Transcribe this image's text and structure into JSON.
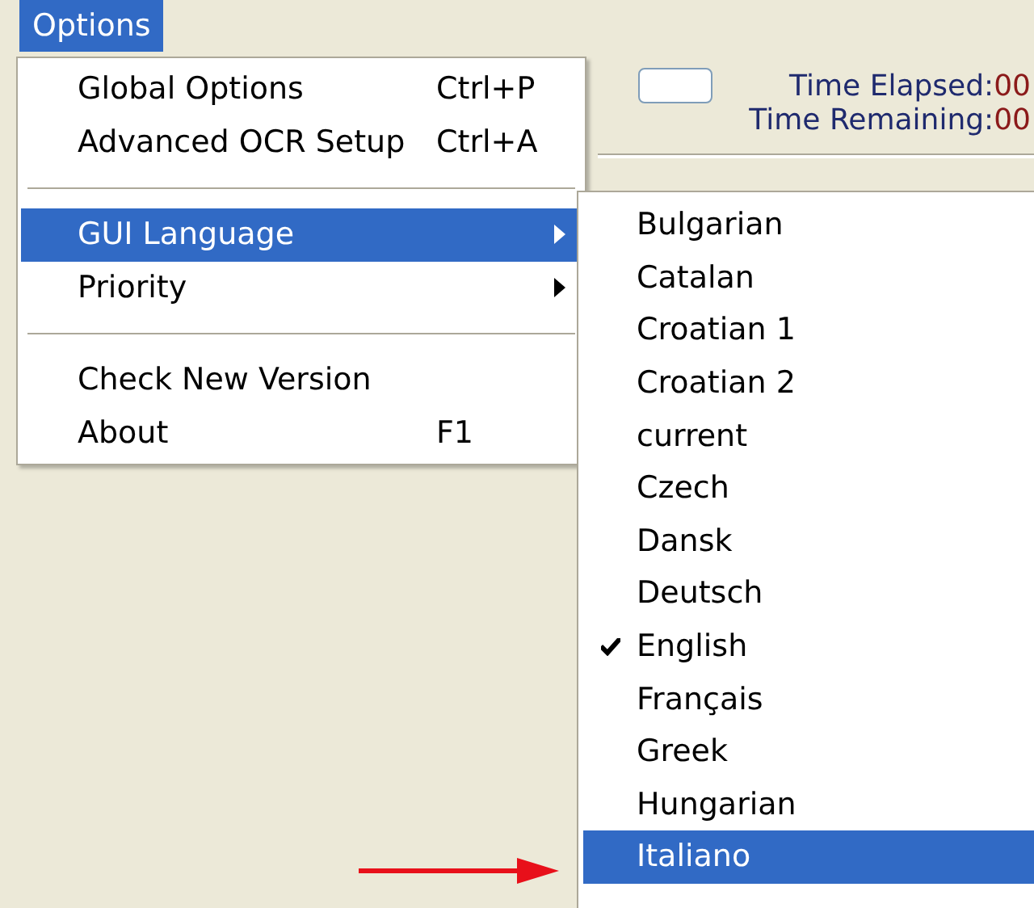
{
  "menubar": [
    {
      "label": "Options",
      "selected": true
    }
  ],
  "background_window": {
    "time_elapsed": {
      "label": "Time Elapsed:",
      "value": "00"
    },
    "time_remaining": {
      "label": "Time Remaining:",
      "value": "00"
    }
  },
  "options_menu": {
    "items": [
      {
        "kind": "item",
        "label": "Global Options",
        "shortcut": "Ctrl+P",
        "selected": false
      },
      {
        "kind": "item",
        "label": "Advanced OCR Setup",
        "shortcut": "Ctrl+A",
        "selected": false
      },
      {
        "kind": "separator"
      },
      {
        "kind": "submenu",
        "label": "GUI Language",
        "selected": true
      },
      {
        "kind": "submenu",
        "label": "Priority",
        "selected": false
      },
      {
        "kind": "separator"
      },
      {
        "kind": "item",
        "label": "Check New Version",
        "selected": false
      },
      {
        "kind": "item",
        "label": "About",
        "shortcut": "F1",
        "selected": false
      }
    ]
  },
  "language_submenu": {
    "items": [
      {
        "label": "Bulgarian",
        "checked": false,
        "selected": false
      },
      {
        "label": "Catalan",
        "checked": false,
        "selected": false
      },
      {
        "label": "Croatian 1",
        "checked": false,
        "selected": false
      },
      {
        "label": "Croatian 2",
        "checked": false,
        "selected": false
      },
      {
        "label": "current",
        "checked": false,
        "selected": false
      },
      {
        "label": "Czech",
        "checked": false,
        "selected": false
      },
      {
        "label": "Dansk",
        "checked": false,
        "selected": false
      },
      {
        "label": "Deutsch",
        "checked": false,
        "selected": false
      },
      {
        "label": "English",
        "checked": true,
        "selected": false
      },
      {
        "label": "Français",
        "checked": false,
        "selected": false
      },
      {
        "label": "Greek",
        "checked": false,
        "selected": false
      },
      {
        "label": "Hungarian",
        "checked": false,
        "selected": false
      },
      {
        "label": "Italiano",
        "checked": false,
        "selected": true
      }
    ]
  }
}
